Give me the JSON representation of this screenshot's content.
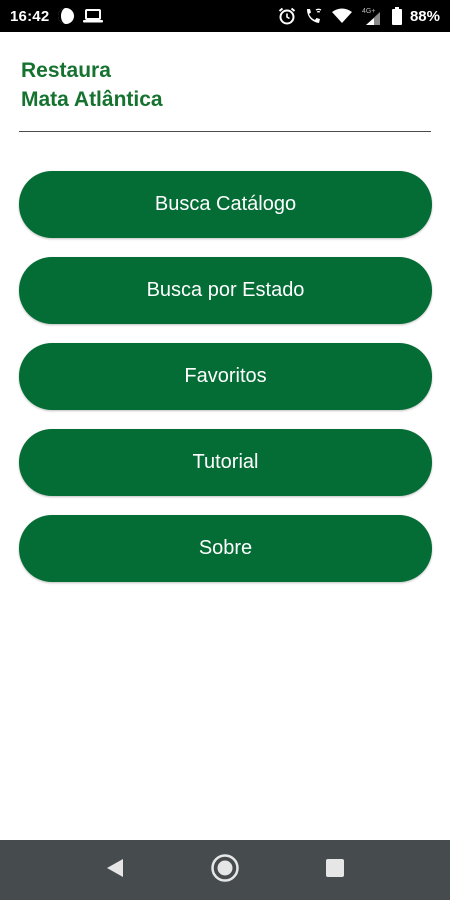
{
  "status_bar": {
    "time": "16:42",
    "battery_percent": "88%",
    "network_label": "4G+",
    "icons": [
      "dnd-half-moon-icon",
      "laptop-icon",
      "alarm-icon",
      "wifi-calling-icon",
      "wifi-icon",
      "signal-icon",
      "battery-icon"
    ]
  },
  "header": {
    "title_line1": "Restaura",
    "title_line2": "Mata Atlântica"
  },
  "menu": {
    "items": [
      {
        "label": "Busca Catálogo"
      },
      {
        "label": "Busca por Estado"
      },
      {
        "label": "Favoritos"
      },
      {
        "label": "Tutorial"
      },
      {
        "label": "Sobre"
      }
    ]
  },
  "nav_bar": {
    "icons": [
      "back-icon",
      "home-icon",
      "recents-icon"
    ]
  },
  "colors": {
    "brand_green": "#046c35",
    "title_green": "#16732f",
    "status_bar": "#000000",
    "nav_bar": "#464c4e"
  }
}
